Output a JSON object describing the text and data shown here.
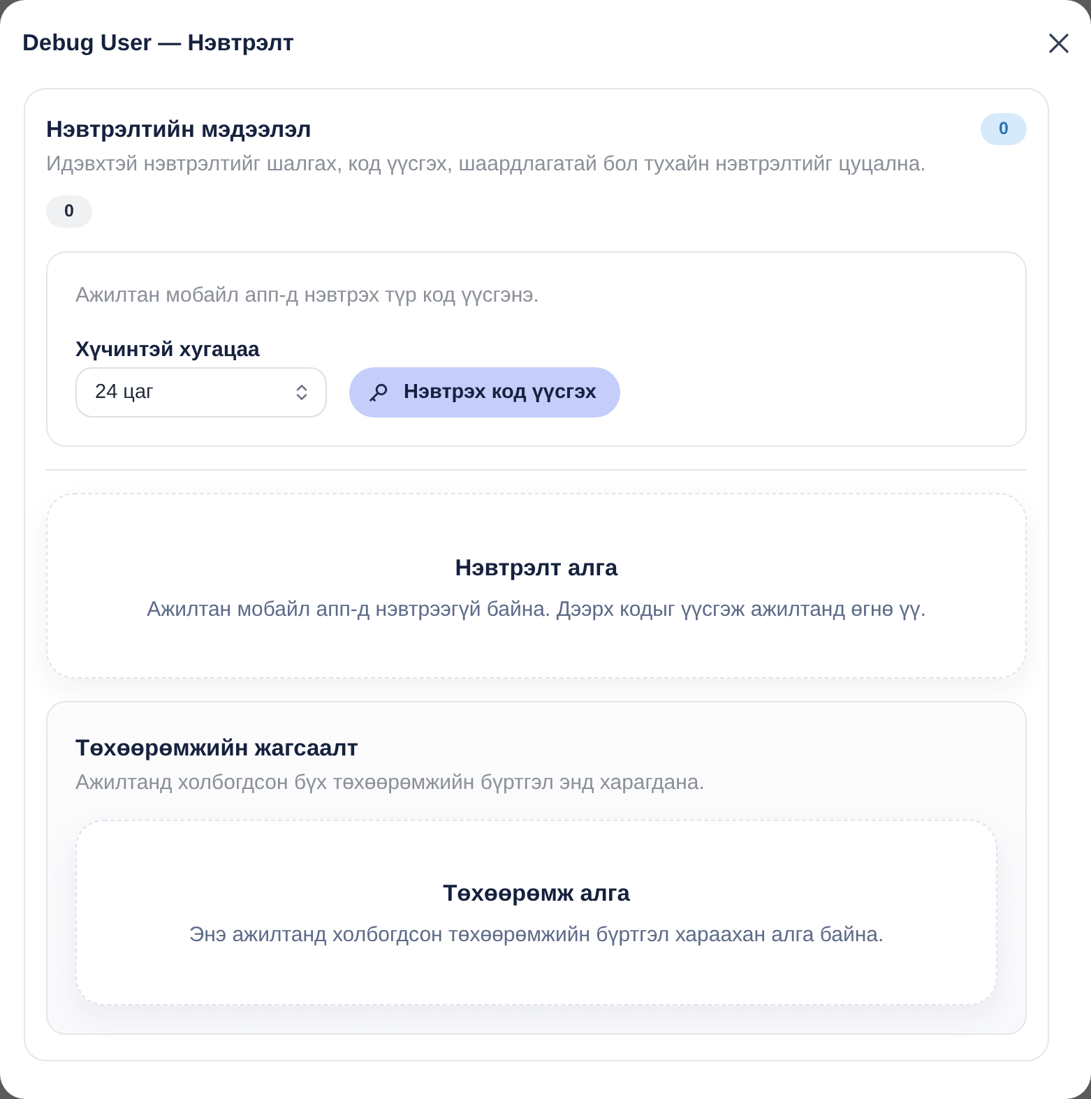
{
  "dialog": {
    "title": "Debug User — Нэвтрэлт"
  },
  "session_info": {
    "title": "Нэвтрэлтийн мэдээлэл",
    "count_badge": "0",
    "description": "Идэвхтэй нэвтрэлтийг шалгах, код үүсгэх, шаардлагатай бол тухайн нэвтрэлтийг цуцална.",
    "status_badge": "0"
  },
  "code_generator": {
    "description": "Ажилтан мобайл апп-д нэвтрэх түр код үүсгэнэ.",
    "validity_label": "Хүчинтэй хугацаа",
    "validity_select": {
      "value": "24 цаг"
    },
    "generate_button": "Нэвтрэх код үүсгэх"
  },
  "sessions_empty": {
    "title": "Нэвтрэлт алга",
    "description": "Ажилтан мобайл апп-д нэвтрээгүй байна. Дээрх кодыг үүсгэж ажилтанд өгнө үү."
  },
  "devices": {
    "title": "Төхөөрөмжийн жагсаалт",
    "description": "Ажилтанд холбогдсон бүх төхөөрөмжийн бүртгэл энд харагдана.",
    "empty": {
      "title": "Төхөөрөмж алга",
      "description": "Энэ ажилтанд холбогдсон төхөөрөмжийн бүртгэл хараахан алга байна."
    }
  }
}
